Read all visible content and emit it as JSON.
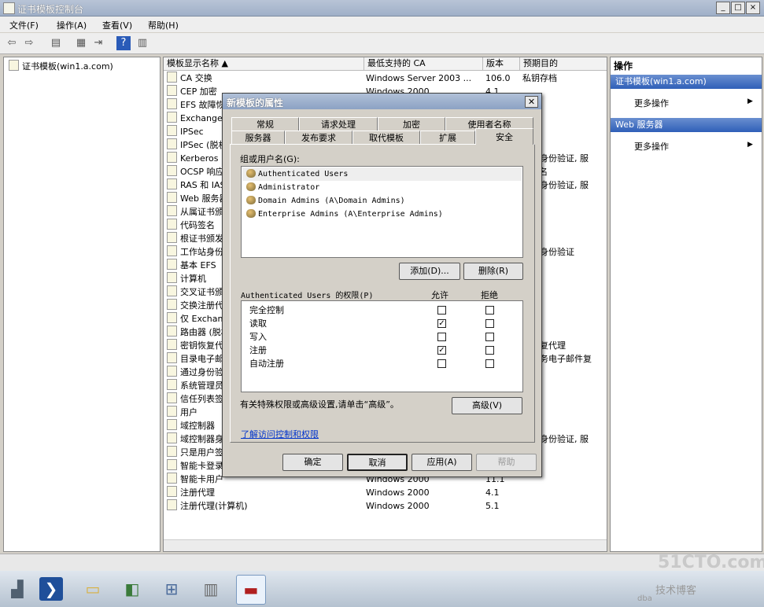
{
  "window": {
    "title": "证书模板控制台",
    "controls": [
      "_",
      "□",
      "×"
    ]
  },
  "menu": [
    "文件(F)",
    "操作(A)",
    "查看(V)",
    "帮助(H)"
  ],
  "tree": {
    "root": "证书模板(win1.a.com)"
  },
  "list": {
    "headers": [
      "模板显示名称",
      "最低支持的 CA",
      "版本",
      "预期目的"
    ],
    "rows": [
      {
        "name": "CA 交换",
        "ca": "Windows Server 2003 ...",
        "ver": "106.0",
        "purpose": "私钥存档"
      },
      {
        "name": "CEP 加密",
        "ca": "Windows 2000",
        "ver": "4.1",
        "purpose": ""
      },
      {
        "name": "EFS 故障恢复代理",
        "ca": "",
        "ver": "",
        "purpose": ""
      },
      {
        "name": "Exchange",
        "ca": "",
        "ver": "",
        "purpose": ""
      },
      {
        "name": "IPSec",
        "ca": "",
        "ver": "",
        "purpose": ""
      },
      {
        "name": "IPSec (脱机申请)",
        "ca": "",
        "ver": "",
        "purpose": ""
      },
      {
        "name": "Kerberos",
        "ca": "",
        "ver": "",
        "purpose": "户端身份验证, 服"
      },
      {
        "name": "OCSP 响应",
        "ca": "",
        "ver": "",
        "purpose": "P 签名"
      },
      {
        "name": "RAS 和 IAS",
        "ca": "",
        "ver": "",
        "purpose": "户端身份验证, 服"
      },
      {
        "name": "Web 服务器",
        "ca": "",
        "ver": "",
        "purpose": ""
      },
      {
        "name": "从属证书颁发机构",
        "ca": "",
        "ver": "",
        "purpose": ""
      },
      {
        "name": "代码签名",
        "ca": "",
        "ver": "",
        "purpose": ""
      },
      {
        "name": "根证书颁发机构",
        "ca": "",
        "ver": "",
        "purpose": ""
      },
      {
        "name": "工作站身份验证",
        "ca": "",
        "ver": "",
        "purpose": "户端身份验证"
      },
      {
        "name": "基本 EFS",
        "ca": "",
        "ver": "",
        "purpose": ""
      },
      {
        "name": "计算机",
        "ca": "",
        "ver": "",
        "purpose": ""
      },
      {
        "name": "交叉证书颁发机构",
        "ca": "",
        "ver": "",
        "purpose": ""
      },
      {
        "name": "交换注册代理",
        "ca": "",
        "ver": "",
        "purpose": ""
      },
      {
        "name": "仅 Exchange 签名",
        "ca": "",
        "ver": "",
        "purpose": ""
      },
      {
        "name": "路由器 (脱机申请)",
        "ca": "",
        "ver": "",
        "purpose": ""
      },
      {
        "name": "密钥恢复代理",
        "ca": "",
        "ver": "",
        "purpose": "钥恢复代理"
      },
      {
        "name": "目录电子邮件复制",
        "ca": "",
        "ver": "",
        "purpose": "录服务电子邮件复"
      },
      {
        "name": "通过身份验证的会话",
        "ca": "",
        "ver": "",
        "purpose": ""
      },
      {
        "name": "系统管理员",
        "ca": "",
        "ver": "",
        "purpose": ""
      },
      {
        "name": "信任列表签名",
        "ca": "",
        "ver": "",
        "purpose": ""
      },
      {
        "name": "用户",
        "ca": "",
        "ver": "",
        "purpose": ""
      },
      {
        "name": "域控制器",
        "ca": "",
        "ver": "",
        "purpose": ""
      },
      {
        "name": "域控制器身份验证",
        "ca": "",
        "ver": "",
        "purpose": "户端身份验证, 服"
      },
      {
        "name": "只是用户签名",
        "ca": "",
        "ver": "",
        "purpose": ""
      },
      {
        "name": "智能卡登录",
        "ca": "",
        "ver": "",
        "purpose": ""
      },
      {
        "name": "智能卡用户",
        "ca": "Windows 2000",
        "ver": "11.1",
        "purpose": ""
      },
      {
        "name": "注册代理",
        "ca": "Windows 2000",
        "ver": "4.1",
        "purpose": ""
      },
      {
        "name": "注册代理(计算机)",
        "ca": "Windows 2000",
        "ver": "5.1",
        "purpose": ""
      }
    ]
  },
  "actions": {
    "header": "操作",
    "groups": [
      {
        "title": "证书模板(win1.a.com)",
        "item": "更多操作"
      },
      {
        "title": "Web 服务器",
        "item": "更多操作"
      }
    ]
  },
  "dialog": {
    "title": "新模板的属性",
    "tabs_row1": [
      "常规",
      "请求处理",
      "加密",
      "使用者名称"
    ],
    "tabs_row2": [
      "服务器",
      "发布要求",
      "取代模板",
      "扩展",
      "安全"
    ],
    "groups_label": "组或用户名(G):",
    "users": [
      "Authenticated Users",
      "Administrator",
      "Domain Admins (A\\Domain Admins)",
      "Enterprise Admins (A\\Enterprise Admins)"
    ],
    "add_button": "添加(D)...",
    "remove_button": "删除(R)",
    "perm_label": "Authenticated Users 的权限(P)",
    "allow_label": "允许",
    "deny_label": "拒绝",
    "permissions": [
      {
        "name": "完全控制",
        "allow": false,
        "deny": false
      },
      {
        "name": "读取",
        "allow": true,
        "deny": false
      },
      {
        "name": "写入",
        "allow": false,
        "deny": false
      },
      {
        "name": "注册",
        "allow": true,
        "deny": false
      },
      {
        "name": "自动注册",
        "allow": false,
        "deny": false
      }
    ],
    "advanced_hint": "有关特殊权限或高级设置,请单击“高级”。",
    "advanced_button": "高级(V)",
    "learn_link": "了解访问控制和权限",
    "ok": "确定",
    "cancel": "取消",
    "apply": "应用(A)",
    "help": "帮助"
  },
  "watermark": {
    "brand": "51CTO.com",
    "sub": "技术博客",
    "blog": "dba"
  }
}
